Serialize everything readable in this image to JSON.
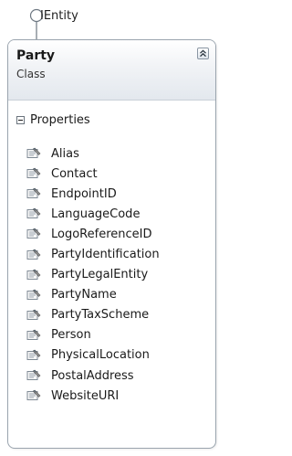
{
  "interface": {
    "name": "IEntity",
    "icon": "interface-lollipop-icon"
  },
  "class": {
    "name": "Party",
    "kind": "Class",
    "collapse_icon": "double-chevron-up-icon",
    "colors": {
      "border": "#9aa4ae",
      "header_top": "#ffffff",
      "header_bottom": "#e3e8ee"
    }
  },
  "section": {
    "label": "Properties",
    "toggle_icon": "minus-box-icon"
  },
  "properties": [
    "Alias",
    "Contact",
    "EndpointID",
    "LanguageCode",
    "LogoReferenceID",
    "PartyIdentification",
    "PartyLegalEntity",
    "PartyName",
    "PartyTaxScheme",
    "Person",
    "PhysicalLocation",
    "PostalAddress",
    "WebsiteURI"
  ],
  "property_icon": "property-wrench-icon"
}
